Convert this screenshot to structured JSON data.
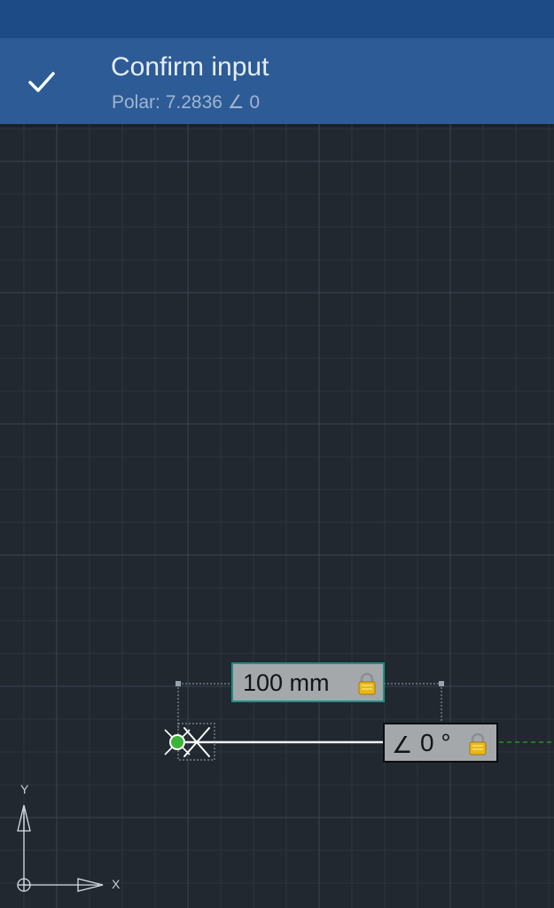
{
  "confirm": {
    "title": "Confirm input",
    "subtitle": "Polar: 7.2836 ∠ 0"
  },
  "distance_input": {
    "value": "100 mm",
    "locked": true
  },
  "angle_input": {
    "symbol": "∠",
    "value": "0 °",
    "locked": true
  },
  "ucs": {
    "x_label": "X",
    "y_label": "Y"
  },
  "colors": {
    "status_bar": "#1d4b86",
    "confirm_bar": "#2d5b95",
    "canvas_bg": "#212830",
    "grid_minor": "#2d353d",
    "grid_major": "#3a4550",
    "input_border_active": "#1e8f84",
    "snap_point": "#3ab53a",
    "polar_track": "#2fa02f",
    "lock_icon": "#e8b81a"
  },
  "icons": {
    "confirm": "checkmark-icon",
    "lock": "padlock-icon",
    "snap": "green-circle-snap-icon",
    "cursor": "crosshair-x-icon",
    "ucs": "ucs-axes-icon"
  }
}
